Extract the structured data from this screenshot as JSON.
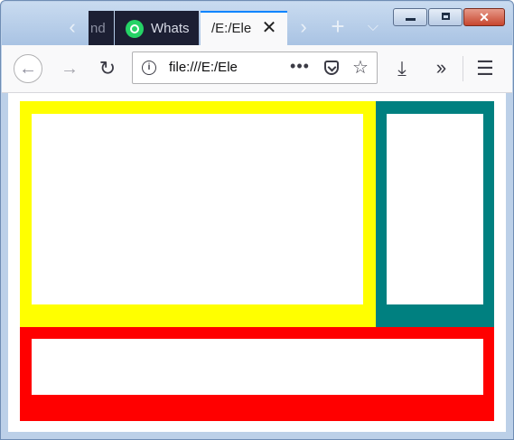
{
  "tabs": [
    {
      "label": "nd"
    },
    {
      "label": "Whats"
    },
    {
      "label": "/E:/Ele"
    }
  ],
  "toolbar": {
    "url": "file:///E:/Ele",
    "url_fade": ""
  },
  "icons": {
    "tab_scroll_left": "chevron-left-icon",
    "tab_scroll_right": "chevron-right-icon",
    "new_tab": "plus-icon",
    "list_all_tabs": "chevron-down-icon",
    "back": "arrow-left-icon",
    "forward": "arrow-right-icon",
    "reload": "reload-icon",
    "site_info": "info-icon",
    "page_actions": "ellipsis-icon",
    "pocket": "pocket-icon",
    "bookmark": "star-icon",
    "downloads": "download-icon",
    "overflow": "double-chevron-icon",
    "menu": "hamburger-icon"
  },
  "colors": {
    "yellow_block": "#ffff00",
    "teal_block": "#008080",
    "red_block": "#ff0000",
    "inner_fill": "#ffffff",
    "tab_accent": "#0a84ff"
  }
}
